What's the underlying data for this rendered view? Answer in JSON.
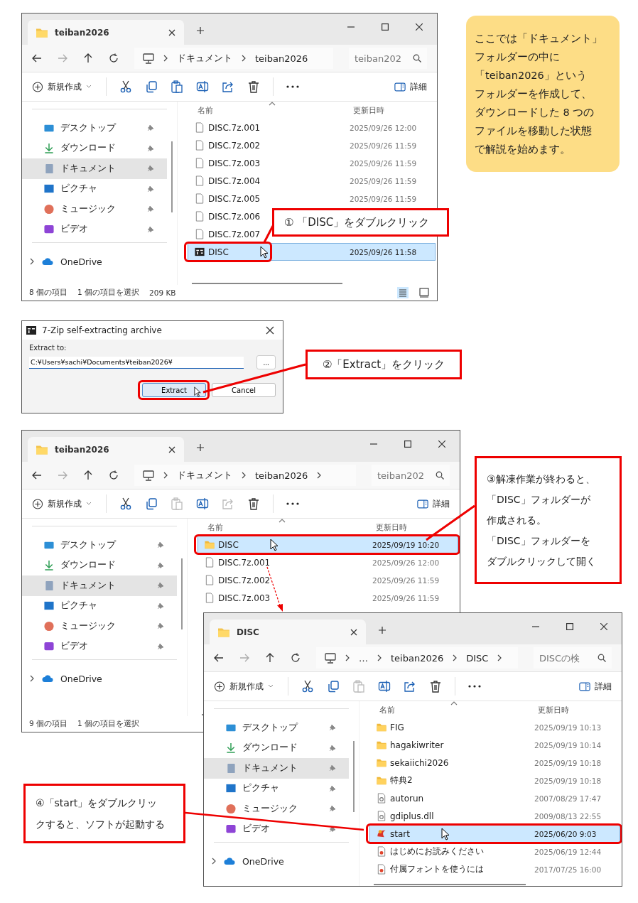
{
  "note": {
    "lines": [
      "ここでは「ドキュメント」",
      "フォルダーの中に",
      "「teiban2026」という",
      "フォルダーを作成して、",
      "ダウンロードした 8 つの",
      "ファイルを移動した状態",
      "で解説を始めます。"
    ]
  },
  "windows": [
    {
      "tab_title": "teiban2026",
      "breadcrumbs": [
        "ドキュメント",
        "teiban2026"
      ],
      "trailing_chevron": false,
      "search_placeholder": "teiban202",
      "new_label": "新規作成",
      "details_label": "詳細",
      "tools": [
        {
          "kind": "cut",
          "disabled": false
        },
        {
          "kind": "copy",
          "disabled": false
        },
        {
          "kind": "paste",
          "disabled": false
        },
        {
          "kind": "rename",
          "disabled": false
        },
        {
          "kind": "share",
          "disabled": false
        },
        {
          "kind": "delete",
          "disabled": false
        }
      ],
      "sidebar": {
        "items": [
          {
            "kind": "desktop",
            "label": "デスクトップ",
            "pinned": true,
            "selected": false
          },
          {
            "kind": "downloads",
            "label": "ダウンロード",
            "pinned": true,
            "selected": false
          },
          {
            "kind": "documents",
            "label": "ドキュメント",
            "pinned": true,
            "selected": true
          },
          {
            "kind": "pictures",
            "label": "ピクチャ",
            "pinned": true,
            "selected": false
          },
          {
            "kind": "music",
            "label": "ミュージック",
            "pinned": true,
            "selected": false
          },
          {
            "kind": "videos",
            "label": "ビデオ",
            "pinned": true,
            "selected": false
          }
        ],
        "drives": [
          {
            "kind": "cloud",
            "label": "OneDrive",
            "expanded": false
          }
        ]
      },
      "columns": [
        "名前",
        "更新日時"
      ],
      "rows": [
        {
          "kind": "file",
          "name": "DISC.7z.001",
          "date": "2025/09/26 12:00",
          "selected": false,
          "hovered": false,
          "highlighted": false
        },
        {
          "kind": "file",
          "name": "DISC.7z.002",
          "date": "2025/09/26 11:59",
          "selected": false,
          "hovered": false,
          "highlighted": false
        },
        {
          "kind": "file",
          "name": "DISC.7z.003",
          "date": "2025/09/26 11:59",
          "selected": false,
          "hovered": false,
          "highlighted": false
        },
        {
          "kind": "file",
          "name": "DISC.7z.004",
          "date": "2025/09/26 11:59",
          "selected": false,
          "hovered": false,
          "highlighted": false
        },
        {
          "kind": "file",
          "name": "DISC.7z.005",
          "date": "2025/09/26 11:59",
          "selected": false,
          "hovered": false,
          "highlighted": false
        },
        {
          "kind": "file",
          "name": "DISC.7z.006",
          "selected": false,
          "hovered": false,
          "highlighted": false
        },
        {
          "kind": "file",
          "name": "DISC.7z.007",
          "selected": false,
          "hovered": false,
          "highlighted": false
        },
        {
          "kind": "archive",
          "name": "DISC",
          "date": "2025/09/26 11:58",
          "selected": true,
          "hovered": true,
          "highlighted": true
        }
      ],
      "status": [
        "8 個の項目",
        "1 個の項目を選択",
        "209 KB"
      ]
    },
    {
      "tab_title": "teiban2026",
      "breadcrumbs": [
        "ドキュメント",
        "teiban2026"
      ],
      "trailing_chevron": true,
      "search_placeholder": "teiban202",
      "new_label": "新規作成",
      "details_label": "詳細",
      "tools": [
        {
          "kind": "cut",
          "disabled": false
        },
        {
          "kind": "copy",
          "disabled": false
        },
        {
          "kind": "paste",
          "disabled": true
        },
        {
          "kind": "rename",
          "disabled": false
        },
        {
          "kind": "share",
          "disabled": true
        },
        {
          "kind": "delete",
          "disabled": false
        }
      ],
      "sidebar": {
        "items": [
          {
            "kind": "desktop",
            "label": "デスクトップ",
            "pinned": true,
            "selected": false
          },
          {
            "kind": "downloads",
            "label": "ダウンロード",
            "pinned": true,
            "selected": false
          },
          {
            "kind": "documents",
            "label": "ドキュメント",
            "pinned": true,
            "selected": true
          },
          {
            "kind": "pictures",
            "label": "ピクチャ",
            "pinned": true,
            "selected": false
          },
          {
            "kind": "music",
            "label": "ミュージック",
            "pinned": true,
            "selected": false
          },
          {
            "kind": "videos",
            "label": "ビデオ",
            "pinned": true,
            "selected": false
          }
        ],
        "drives": [
          {
            "kind": "cloud",
            "label": "OneDrive",
            "expanded": false
          }
        ]
      },
      "columns": [
        "名前",
        "更新日時"
      ],
      "rows": [
        {
          "kind": "folder",
          "name": "DISC",
          "date": "2025/09/19 10:20",
          "selected": true,
          "hovered": true,
          "highlighted": true
        },
        {
          "kind": "file",
          "name": "DISC.7z.001",
          "date": "2025/09/26 12:00",
          "selected": false,
          "hovered": false,
          "highlighted": false
        },
        {
          "kind": "file",
          "name": "DISC.7z.002",
          "date": "2025/09/26 11:59",
          "selected": false,
          "hovered": false,
          "highlighted": false
        },
        {
          "kind": "file",
          "name": "DISC.7z.003",
          "date": "2025/09/26 11:59",
          "selected": false,
          "hovered": false,
          "highlighted": false
        }
      ],
      "status": [
        "9 個の項目",
        "1 個の項目を選択"
      ]
    },
    {
      "tab_title": "DISC",
      "breadcrumbs": [
        "…",
        "teiban2026",
        "DISC"
      ],
      "trailing_chevron": true,
      "search_placeholder": "DISCの検",
      "new_label": "新規作成",
      "details_label": "詳細",
      "tools": [
        {
          "kind": "cut",
          "disabled": false
        },
        {
          "kind": "copy",
          "disabled": false
        },
        {
          "kind": "paste",
          "disabled": true
        },
        {
          "kind": "rename",
          "disabled": false
        },
        {
          "kind": "share",
          "disabled": false
        },
        {
          "kind": "delete",
          "disabled": false
        }
      ],
      "sidebar": {
        "items": [
          {
            "kind": "desktop",
            "label": "デスクトップ",
            "pinned": true,
            "selected": false
          },
          {
            "kind": "downloads",
            "label": "ダウンロード",
            "pinned": true,
            "selected": false
          },
          {
            "kind": "documents",
            "label": "ドキュメント",
            "pinned": true,
            "selected": true
          },
          {
            "kind": "pictures",
            "label": "ピクチャ",
            "pinned": true,
            "selected": false
          },
          {
            "kind": "music",
            "label": "ミュージック",
            "pinned": true,
            "selected": false
          },
          {
            "kind": "videos",
            "label": "ビデオ",
            "pinned": true,
            "selected": false
          }
        ],
        "drives": [
          {
            "kind": "cloud",
            "label": "OneDrive",
            "expanded": false
          }
        ]
      },
      "columns": [
        "名前",
        "更新日時"
      ],
      "rows": [
        {
          "kind": "folder",
          "name": "FIG",
          "date": "2025/09/19 10:13",
          "selected": false,
          "hovered": false,
          "highlighted": false
        },
        {
          "kind": "folder",
          "name": "hagakiwriter",
          "date": "2025/09/19 10:14",
          "selected": false,
          "hovered": false,
          "highlighted": false
        },
        {
          "kind": "folder",
          "name": "sekaiichi2026",
          "date": "2025/09/19 10:18",
          "selected": false,
          "hovered": false,
          "highlighted": false
        },
        {
          "kind": "folder",
          "name": "特典2",
          "date": "2025/09/19 10:18",
          "selected": false,
          "hovered": false,
          "highlighted": false
        },
        {
          "kind": "setup",
          "name": "autorun",
          "date": "2007/08/29 17:47",
          "selected": false,
          "hovered": false,
          "highlighted": false
        },
        {
          "kind": "dll",
          "name": "gdiplus.dll",
          "date": "2009/08/13 22:55",
          "selected": false,
          "hovered": false,
          "highlighted": false
        },
        {
          "kind": "app",
          "name": "start",
          "date": "2025/06/20 9:03",
          "selected": true,
          "hovered": true,
          "highlighted": true
        },
        {
          "kind": "web",
          "name": "はじめにお読みください",
          "date": "2025/06/19 12:44",
          "selected": false,
          "hovered": false,
          "highlighted": false
        },
        {
          "kind": "web",
          "name": "付属フォントを使うには",
          "date": "2017/07/25 16:00",
          "selected": false,
          "hovered": false,
          "highlighted": false
        }
      ]
    }
  ],
  "dialog": {
    "title": "7-Zip self-extracting archive",
    "label": "Extract to:",
    "path": "C:¥Users¥sachi¥Documents¥teiban2026¥",
    "browse": "...",
    "buttons": [
      {
        "label": "Extract",
        "hovered": true,
        "highlighted": true
      },
      {
        "label": "Cancel",
        "hovered": false,
        "highlighted": false
      }
    ]
  },
  "callouts": [
    {
      "lines": [
        "① 「DISC」をダブルクリック"
      ]
    },
    {
      "lines": [
        "②「Extract」をクリック"
      ]
    },
    {
      "lines": [
        "③解凍作業が終わると、",
        "「DISC」フォルダーが",
        "作成される。",
        "「DISC」フォルダーを",
        "ダブルクリックして開く"
      ]
    },
    {
      "lines": [
        "④「start」をダブルクリッ",
        "クすると、ソフトが起動する"
      ]
    }
  ]
}
